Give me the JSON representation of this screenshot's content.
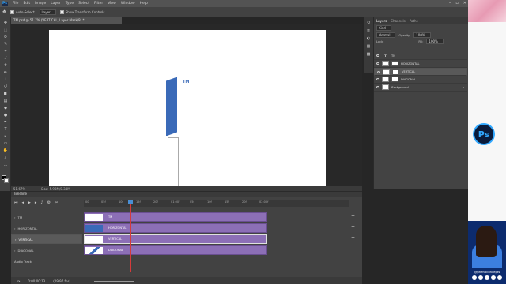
{
  "menubar": {
    "logo": "Ps",
    "items": [
      "File",
      "Edit",
      "Image",
      "Layer",
      "Type",
      "Select",
      "Filter",
      "View",
      "Window",
      "Help"
    ],
    "window_controls": [
      "–",
      "▫",
      "✕"
    ]
  },
  "options": {
    "auto_select_label": "Auto-Select:",
    "auto_select_value": "Layer",
    "transform_label": "Show Transform Controls"
  },
  "document": {
    "tab_title": "TM.psd @ 51.7% (VERTICAL, Layer Mask/8) *",
    "zoom": "51.67%",
    "doc_info": "Doc: 5.93M/8.34M"
  },
  "canvas": {
    "logo_text": "TM"
  },
  "layers_panel": {
    "tabs": [
      "Layers",
      "Channels",
      "Paths"
    ],
    "kind_label": "Kind",
    "blend_mode": "Normal",
    "opacity_label": "Opacity:",
    "opacity_value": "100%",
    "lock_label": "Lock:",
    "fill_label": "Fill:",
    "fill_value": "100%",
    "layers": [
      {
        "name": "TM",
        "type": "text"
      },
      {
        "name": "HORIZONTAL",
        "type": "masked"
      },
      {
        "name": "VERTICAL",
        "type": "masked",
        "selected": true
      },
      {
        "name": "DIAGONAL",
        "type": "masked"
      },
      {
        "name": "Background",
        "type": "plain"
      }
    ]
  },
  "timeline": {
    "title": "Timeline",
    "ruler": [
      "00",
      "05f",
      "10f",
      "15f",
      "20f",
      "01:00f",
      "05f",
      "10f",
      "15f",
      "20f",
      "02:00f"
    ],
    "tracks": [
      {
        "label": "TM",
        "clip": "TM"
      },
      {
        "label": "HORIZONTAL",
        "clip": "HORIZONTAL"
      },
      {
        "label": "VERTICAL",
        "clip": "VERTICAL"
      },
      {
        "label": "DIAGONAL",
        "clip": "DIAGONAL"
      }
    ],
    "audio_label": "Audio Track",
    "timecode": "0:00:00:13",
    "fps": "(29.97 fps)"
  },
  "sidebar_badge": "Ps",
  "webcam": {
    "handle": "@phenoconcepts"
  }
}
